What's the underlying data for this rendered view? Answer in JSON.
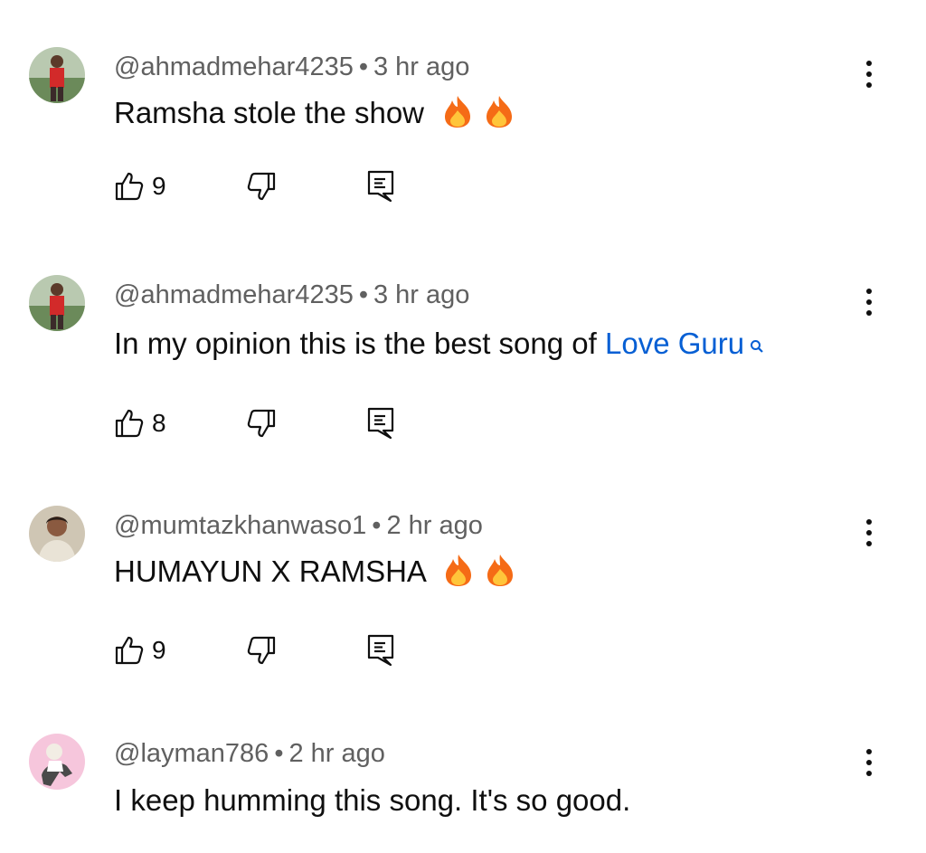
{
  "comments": [
    {
      "handle": "@ahmadmehar4235",
      "time": "3 hr ago",
      "text": "Ramsha stole the show",
      "emoji": [
        "fire",
        "fire"
      ],
      "likes": "9",
      "avatar": "avatar-man-red-shirt"
    },
    {
      "handle": "@ahmadmehar4235",
      "time": "3 hr ago",
      "text": "In my opinion this is the best song of ",
      "link_text": "Love Guru",
      "likes": "8",
      "avatar": "avatar-man-red-shirt"
    },
    {
      "handle": "@mumtazkhanwaso1",
      "time": "2 hr ago",
      "text": "HUMAYUN X RAMSHA",
      "emoji": [
        "fire",
        "fire"
      ],
      "likes": "9",
      "avatar": "avatar-woman-portrait"
    },
    {
      "handle": "@layman786",
      "time": "2 hr ago",
      "text": "I keep humming this song. It's so good.",
      "avatar": "avatar-man-pink-bg"
    }
  ],
  "colors": {
    "link": "#065fd4",
    "meta": "#606060",
    "text": "#0f0f0f"
  },
  "meta_separator": "•",
  "icons": [
    "thumbs-up-icon",
    "thumbs-down-icon",
    "reply-icon",
    "more-vert-icon",
    "fire-emoji",
    "search-icon"
  ]
}
